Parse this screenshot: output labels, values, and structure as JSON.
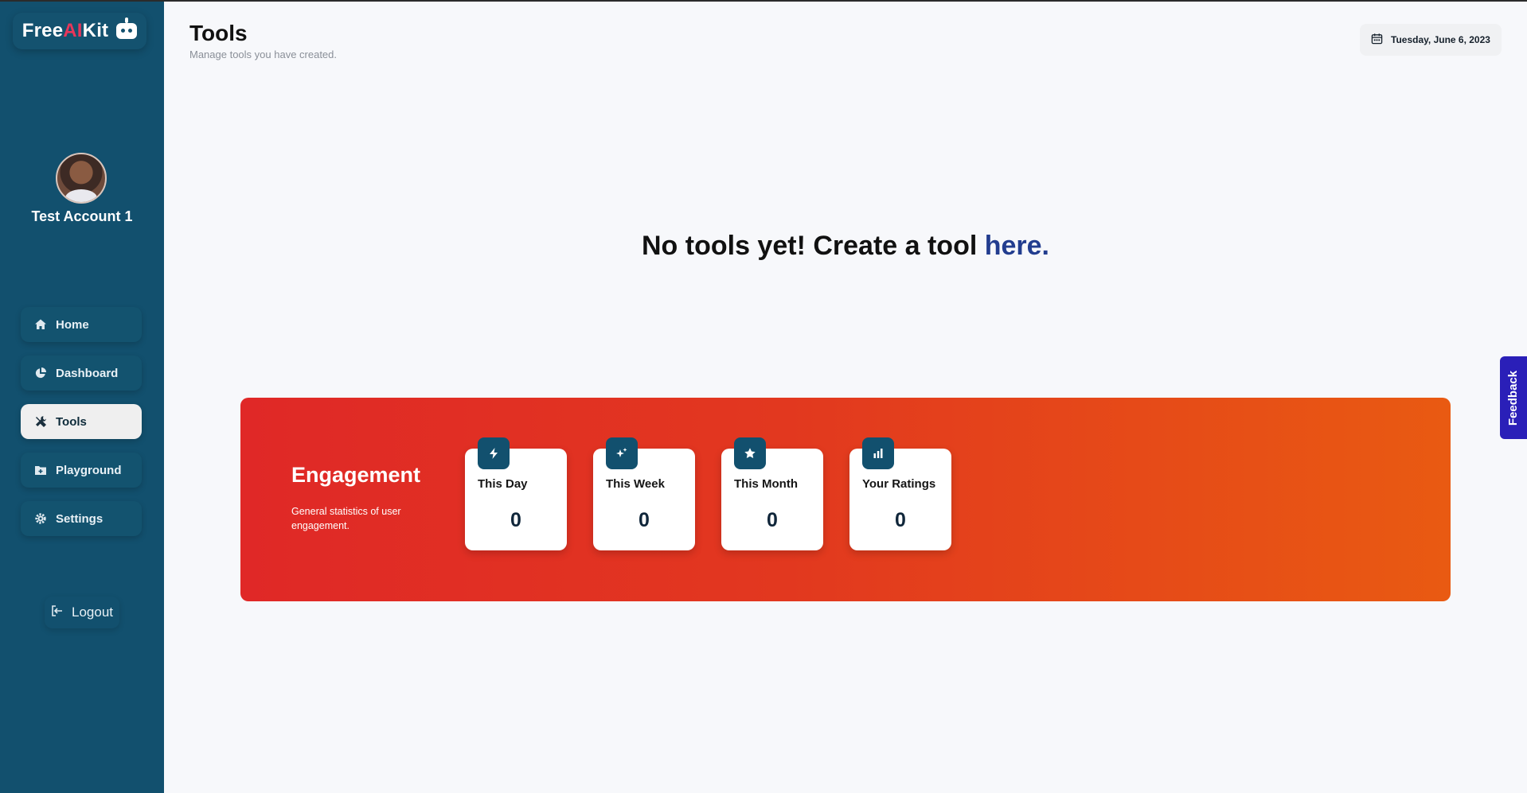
{
  "app": {
    "logo": {
      "part1": "Free",
      "part2": "AI",
      "part3": "Kit"
    },
    "brand_color": "#12506e",
    "accent_color": "#e8365a"
  },
  "user": {
    "name": "Test Account 1"
  },
  "sidebar": {
    "items": [
      {
        "label": "Home",
        "icon": "home-icon",
        "active": false
      },
      {
        "label": "Dashboard",
        "icon": "pie-chart-icon",
        "active": false
      },
      {
        "label": "Tools",
        "icon": "tools-icon",
        "active": true
      },
      {
        "label": "Playground",
        "icon": "folder-plus-icon",
        "active": false
      },
      {
        "label": "Settings",
        "icon": "gear-icon",
        "active": false
      }
    ],
    "logout_label": "Logout"
  },
  "header": {
    "title": "Tools",
    "subtitle": "Manage tools you have created.",
    "date": "Tuesday, June 6, 2023"
  },
  "empty_state": {
    "text": "No tools yet! Create a tool ",
    "link": "here."
  },
  "engagement": {
    "title": "Engagement",
    "description": "General statistics of user engagement.",
    "stats": [
      {
        "label": "This Day",
        "value": "0",
        "icon": "lightning-icon"
      },
      {
        "label": "This Week",
        "value": "0",
        "icon": "sparkle-icon"
      },
      {
        "label": "This Month",
        "value": "0",
        "icon": "star-icon"
      },
      {
        "label": "Your Ratings",
        "value": "0",
        "icon": "bar-chart-icon"
      }
    ]
  },
  "feedback": {
    "label": "Feedback"
  }
}
